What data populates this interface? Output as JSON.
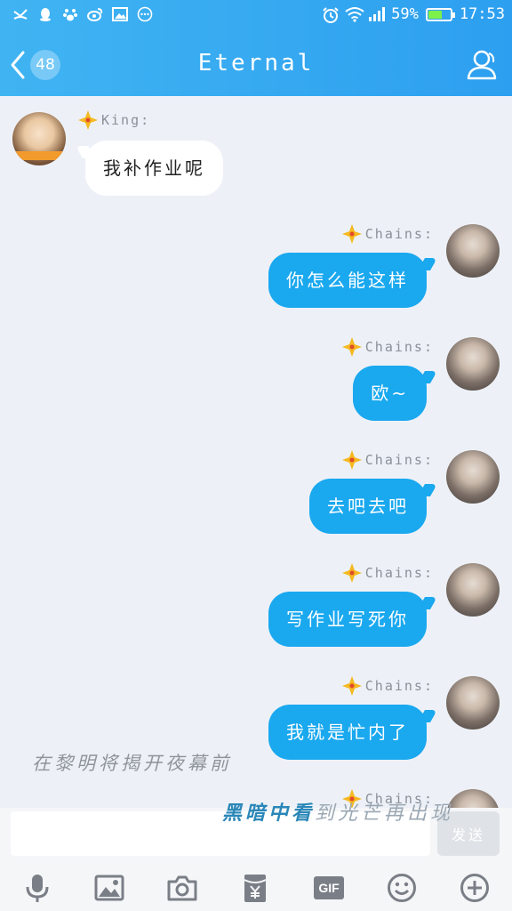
{
  "status_bar": {
    "icons_left": [
      "missed-call-icon",
      "qq-icon",
      "paw-icon",
      "weibo-icon",
      "image-icon",
      "more-icon"
    ],
    "icons_right": [
      "alarm-icon",
      "wifi-icon",
      "signal-icon",
      "battery-icon"
    ],
    "battery_percent": "59%",
    "battery_level": 0.59,
    "time": "17:53"
  },
  "header": {
    "unread_count": "48",
    "title": "Eternal"
  },
  "messages": [
    {
      "sender": "King:",
      "text": "我补作业呢",
      "direction": "in"
    },
    {
      "sender": "Chains:",
      "text": "你怎么能这样",
      "direction": "out"
    },
    {
      "sender": "Chains:",
      "text": "欧~",
      "direction": "out"
    },
    {
      "sender": "Chains:",
      "text": "去吧去吧",
      "direction": "out"
    },
    {
      "sender": "Chains:",
      "text": "写作业写死你",
      "direction": "out"
    },
    {
      "sender": "Chains:",
      "text": "我就是忙内了",
      "direction": "out"
    },
    {
      "sender": "Chains:",
      "text": "",
      "direction": "out"
    }
  ],
  "overlay_text": {
    "line1": "在黎明将揭开夜幕前",
    "line2_dark": "黑暗中看",
    "line2_light": "到光芒再出现"
  },
  "input": {
    "value": "",
    "placeholder": "",
    "send_label": "发送"
  },
  "toolbar": {
    "items": [
      "microphone-icon",
      "image-icon",
      "camera-icon",
      "red-packet-icon",
      "gif-icon",
      "emoji-icon",
      "plus-icon"
    ],
    "gif_label": "GIF"
  },
  "colors": {
    "header_gradient_start": "#40b4f2",
    "header_gradient_end": "#2d9ff0",
    "outgoing_bubble": "#1aa8ef",
    "incoming_bubble": "#ffffff",
    "chat_background": "#edf1f7"
  }
}
